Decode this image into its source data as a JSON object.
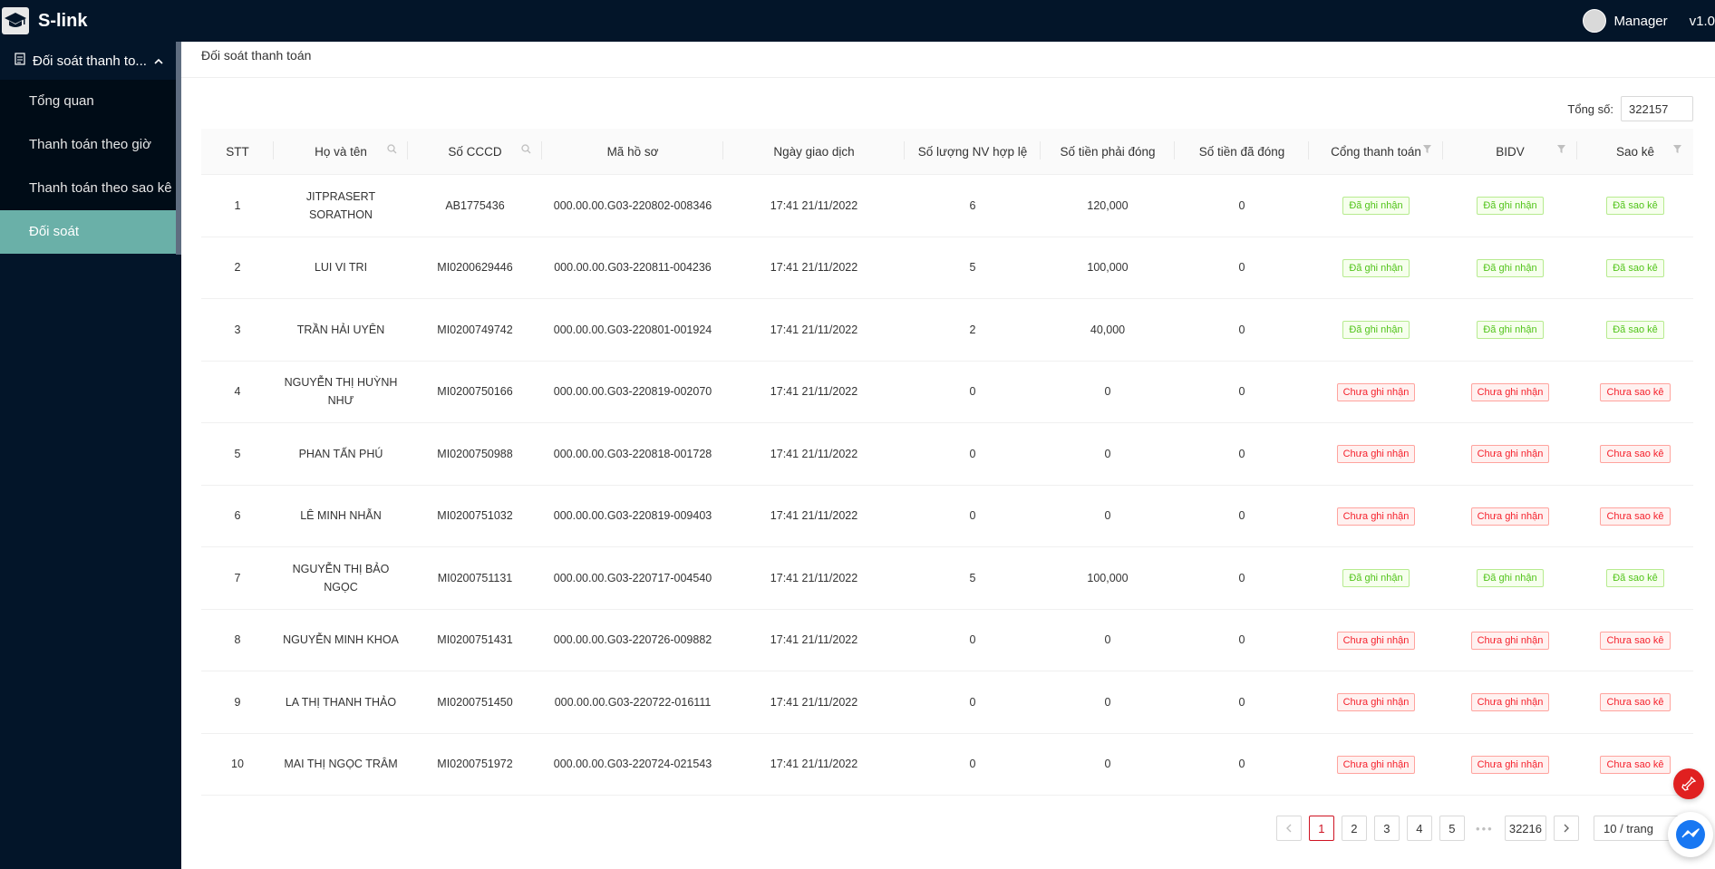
{
  "app": {
    "name": "S-link",
    "user": "Manager",
    "version": "v1.0"
  },
  "sidebar": {
    "group_label": "Đối soát thanh to...",
    "items": [
      {
        "label": "Tổng quan",
        "active": false
      },
      {
        "label": "Thanh toán theo giờ",
        "active": false
      },
      {
        "label": "Thanh toán theo sao kê",
        "active": false
      },
      {
        "label": "Đối soát",
        "active": true
      }
    ]
  },
  "page": {
    "title": "Đối soát thanh toán",
    "total_label": "Tổng số:",
    "total_value": "322157"
  },
  "table": {
    "columns": [
      {
        "label": "STT",
        "icon": ""
      },
      {
        "label": "Họ và tên",
        "icon": "search-icon"
      },
      {
        "label": "Số CCCD",
        "icon": "search-icon"
      },
      {
        "label": "Mã hồ sơ",
        "icon": ""
      },
      {
        "label": "Ngày giao dịch",
        "icon": ""
      },
      {
        "label": "Số lượng NV hợp lệ",
        "icon": ""
      },
      {
        "label": "Số tiền phải đóng",
        "icon": ""
      },
      {
        "label": "Số tiền đã đóng",
        "icon": ""
      },
      {
        "label": "Cổng thanh toán",
        "icon": "filter-icon"
      },
      {
        "label": "BIDV",
        "icon": "filter-icon"
      },
      {
        "label": "Sao kê",
        "icon": "filter-icon"
      }
    ],
    "rows": [
      {
        "stt": "1",
        "name": "JITPRASERT SORATHON",
        "cccd": "AB1775436",
        "ma_ho_so": "000.00.00.G03-220802-008346",
        "date": "17:41 21/11/2022",
        "nv": "6",
        "phai_dong": "120,000",
        "da_dong": "0",
        "cong": "Đã ghi nhận",
        "bidv": "Đã ghi nhận",
        "sao_ke": "Đã sao kê",
        "ok": true
      },
      {
        "stt": "2",
        "name": "LUI VI TRI",
        "cccd": "MI0200629446",
        "ma_ho_so": "000.00.00.G03-220811-004236",
        "date": "17:41 21/11/2022",
        "nv": "5",
        "phai_dong": "100,000",
        "da_dong": "0",
        "cong": "Đã ghi nhận",
        "bidv": "Đã ghi nhận",
        "sao_ke": "Đã sao kê",
        "ok": true
      },
      {
        "stt": "3",
        "name": "TRẦN HẢI UYÊN",
        "cccd": "MI0200749742",
        "ma_ho_so": "000.00.00.G03-220801-001924",
        "date": "17:41 21/11/2022",
        "nv": "2",
        "phai_dong": "40,000",
        "da_dong": "0",
        "cong": "Đã ghi nhận",
        "bidv": "Đã ghi nhận",
        "sao_ke": "Đã sao kê",
        "ok": true
      },
      {
        "stt": "4",
        "name": "NGUYỄN THỊ HUỲNH NHƯ",
        "cccd": "MI0200750166",
        "ma_ho_so": "000.00.00.G03-220819-002070",
        "date": "17:41 21/11/2022",
        "nv": "0",
        "phai_dong": "0",
        "da_dong": "0",
        "cong": "Chưa ghi nhận",
        "bidv": "Chưa ghi nhận",
        "sao_ke": "Chưa sao kê",
        "ok": false
      },
      {
        "stt": "5",
        "name": "PHAN TẤN PHÚ",
        "cccd": "MI0200750988",
        "ma_ho_so": "000.00.00.G03-220818-001728",
        "date": "17:41 21/11/2022",
        "nv": "0",
        "phai_dong": "0",
        "da_dong": "0",
        "cong": "Chưa ghi nhận",
        "bidv": "Chưa ghi nhận",
        "sao_ke": "Chưa sao kê",
        "ok": false
      },
      {
        "stt": "6",
        "name": "LÊ MINH NHẪN",
        "cccd": "MI0200751032",
        "ma_ho_so": "000.00.00.G03-220819-009403",
        "date": "17:41 21/11/2022",
        "nv": "0",
        "phai_dong": "0",
        "da_dong": "0",
        "cong": "Chưa ghi nhận",
        "bidv": "Chưa ghi nhận",
        "sao_ke": "Chưa sao kê",
        "ok": false
      },
      {
        "stt": "7",
        "name": "NGUYỄN THỊ BẢO NGỌC",
        "cccd": "MI0200751131",
        "ma_ho_so": "000.00.00.G03-220717-004540",
        "date": "17:41 21/11/2022",
        "nv": "5",
        "phai_dong": "100,000",
        "da_dong": "0",
        "cong": "Đã ghi nhận",
        "bidv": "Đã ghi nhận",
        "sao_ke": "Đã sao kê",
        "ok": true
      },
      {
        "stt": "8",
        "name": "NGUYỄN MINH KHOA",
        "cccd": "MI0200751431",
        "ma_ho_so": "000.00.00.G03-220726-009882",
        "date": "17:41 21/11/2022",
        "nv": "0",
        "phai_dong": "0",
        "da_dong": "0",
        "cong": "Chưa ghi nhận",
        "bidv": "Chưa ghi nhận",
        "sao_ke": "Chưa sao kê",
        "ok": false
      },
      {
        "stt": "9",
        "name": "LA THỊ THANH THẢO",
        "cccd": "MI0200751450",
        "ma_ho_so": "000.00.00.G03-220722-016111",
        "date": "17:41 21/11/2022",
        "nv": "0",
        "phai_dong": "0",
        "da_dong": "0",
        "cong": "Chưa ghi nhận",
        "bidv": "Chưa ghi nhận",
        "sao_ke": "Chưa sao kê",
        "ok": false
      },
      {
        "stt": "10",
        "name": "MAI THỊ NGỌC TRÂM",
        "cccd": "MI0200751972",
        "ma_ho_so": "000.00.00.G03-220724-021543",
        "date": "17:41 21/11/2022",
        "nv": "0",
        "phai_dong": "0",
        "da_dong": "0",
        "cong": "Chưa ghi nhận",
        "bidv": "Chưa ghi nhận",
        "sao_ke": "Chưa sao kê",
        "ok": false
      }
    ]
  },
  "pagination": {
    "pages": [
      "1",
      "2",
      "3",
      "4",
      "5"
    ],
    "current": "1",
    "ellipsis": "•••",
    "last": "32216",
    "page_size": "10 / trang"
  },
  "colors": {
    "header_bg": "#031529",
    "active_menu": "#6ab0a8",
    "tag_ok": "#52c41a",
    "tag_no": "#f5222d"
  }
}
